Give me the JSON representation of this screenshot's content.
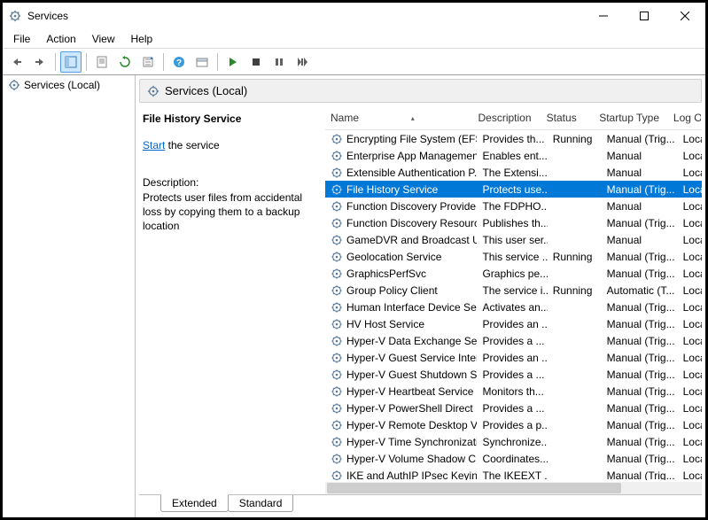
{
  "window": {
    "title": "Services"
  },
  "menu": [
    "File",
    "Action",
    "View",
    "Help"
  ],
  "tree": {
    "root": "Services (Local)"
  },
  "paneheader": "Services (Local)",
  "info": {
    "service_name": "File History Service",
    "start_link": "Start",
    "start_suffix": " the service",
    "desc_label": "Description:",
    "desc_text": "Protects user files from accidental loss by copying them to a backup location"
  },
  "columns": {
    "name": "Name",
    "description": "Description",
    "status": "Status",
    "startup": "Startup Type",
    "logon": "Log On As"
  },
  "tabs": {
    "extended": "Extended",
    "standard": "Standard"
  },
  "rows": [
    {
      "name": "Encrypting File System (EFS)",
      "desc": "Provides th...",
      "status": "Running",
      "startup": "Manual (Trig...",
      "logon": "Loca",
      "selected": false
    },
    {
      "name": "Enterprise App Managemen...",
      "desc": "Enables ent...",
      "status": "",
      "startup": "Manual",
      "logon": "Loca",
      "selected": false
    },
    {
      "name": "Extensible Authentication P...",
      "desc": "The Extensi...",
      "status": "",
      "startup": "Manual",
      "logon": "Loca",
      "selected": false
    },
    {
      "name": "File History Service",
      "desc": "Protects use...",
      "status": "",
      "startup": "Manual (Trig...",
      "logon": "Loca",
      "selected": true
    },
    {
      "name": "Function Discovery Provide...",
      "desc": "The FDPHO...",
      "status": "",
      "startup": "Manual",
      "logon": "Loca",
      "selected": false
    },
    {
      "name": "Function Discovery Resourc...",
      "desc": "Publishes th...",
      "status": "",
      "startup": "Manual (Trig...",
      "logon": "Loca",
      "selected": false
    },
    {
      "name": "GameDVR and Broadcast Us...",
      "desc": "This user ser...",
      "status": "",
      "startup": "Manual",
      "logon": "Loca",
      "selected": false
    },
    {
      "name": "Geolocation Service",
      "desc": "This service ...",
      "status": "Running",
      "startup": "Manual (Trig...",
      "logon": "Loca",
      "selected": false
    },
    {
      "name": "GraphicsPerfSvc",
      "desc": "Graphics pe...",
      "status": "",
      "startup": "Manual (Trig...",
      "logon": "Loca",
      "selected": false
    },
    {
      "name": "Group Policy Client",
      "desc": "The service i...",
      "status": "Running",
      "startup": "Automatic (T...",
      "logon": "Loca",
      "selected": false
    },
    {
      "name": "Human Interface Device Ser...",
      "desc": "Activates an...",
      "status": "",
      "startup": "Manual (Trig...",
      "logon": "Loca",
      "selected": false
    },
    {
      "name": "HV Host Service",
      "desc": "Provides an ...",
      "status": "",
      "startup": "Manual (Trig...",
      "logon": "Loca",
      "selected": false
    },
    {
      "name": "Hyper-V Data Exchange Ser...",
      "desc": "Provides a ...",
      "status": "",
      "startup": "Manual (Trig...",
      "logon": "Loca",
      "selected": false
    },
    {
      "name": "Hyper-V Guest Service Inter...",
      "desc": "Provides an ...",
      "status": "",
      "startup": "Manual (Trig...",
      "logon": "Loca",
      "selected": false
    },
    {
      "name": "Hyper-V Guest Shutdown S...",
      "desc": "Provides a ...",
      "status": "",
      "startup": "Manual (Trig...",
      "logon": "Loca",
      "selected": false
    },
    {
      "name": "Hyper-V Heartbeat Service",
      "desc": "Monitors th...",
      "status": "",
      "startup": "Manual (Trig...",
      "logon": "Loca",
      "selected": false
    },
    {
      "name": "Hyper-V PowerShell Direct ...",
      "desc": "Provides a ...",
      "status": "",
      "startup": "Manual (Trig...",
      "logon": "Loca",
      "selected": false
    },
    {
      "name": "Hyper-V Remote Desktop Vi...",
      "desc": "Provides a p...",
      "status": "",
      "startup": "Manual (Trig...",
      "logon": "Loca",
      "selected": false
    },
    {
      "name": "Hyper-V Time Synchronizati...",
      "desc": "Synchronize...",
      "status": "",
      "startup": "Manual (Trig...",
      "logon": "Loca",
      "selected": false
    },
    {
      "name": "Hyper-V Volume Shadow C...",
      "desc": "Coordinates...",
      "status": "",
      "startup": "Manual (Trig...",
      "logon": "Loca",
      "selected": false
    },
    {
      "name": "IKE and AuthIP IPsec Keying...",
      "desc": "The IKEEXT ...",
      "status": "",
      "startup": "Manual (Trig...",
      "logon": "Loca",
      "selected": false
    }
  ]
}
